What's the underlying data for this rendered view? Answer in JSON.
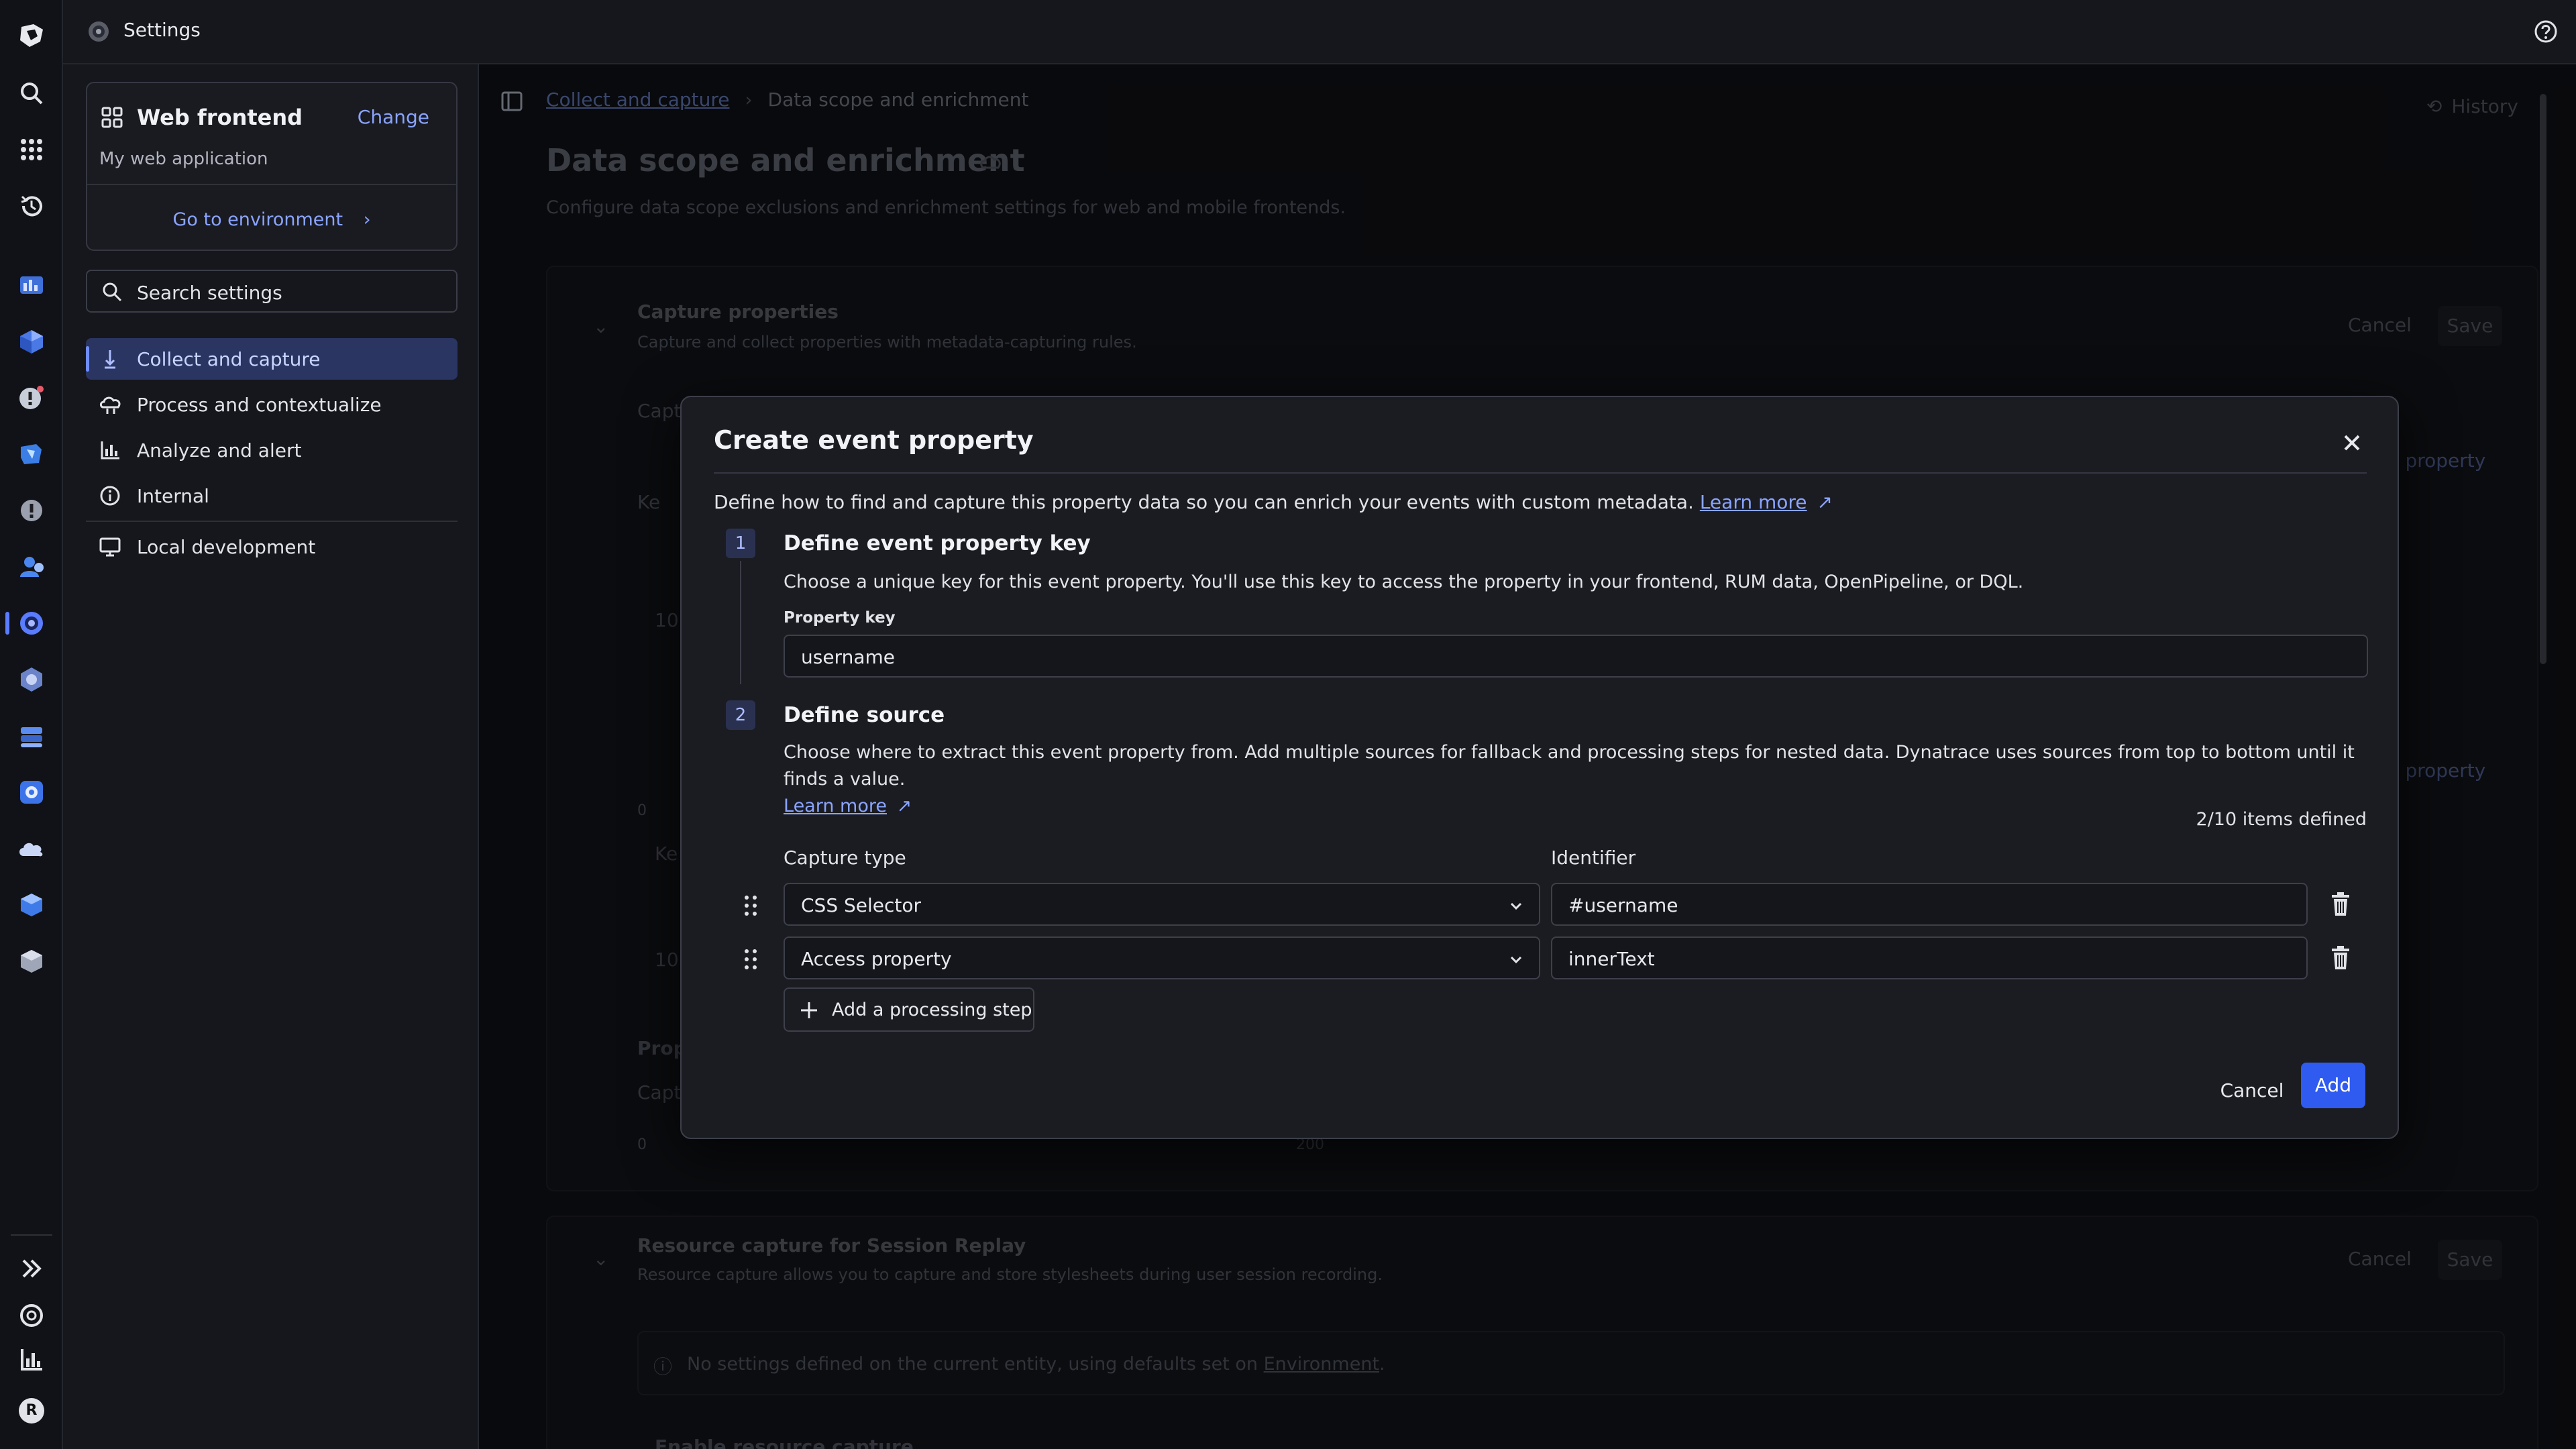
{
  "app": {
    "title": "Settings"
  },
  "rail": {
    "icons": [
      "dynatrace-logo-icon",
      "search-icon",
      "apps-grid-icon",
      "recent-history-icon",
      "dashboard-app-icon",
      "hub-app-icon",
      "problems-app-icon",
      "infrastructure-app-icon",
      "alerts-app-icon",
      "users-app-icon",
      "settings-app-icon",
      "kubernetes-app-icon",
      "databases-app-icon",
      "services-app-icon",
      "clouds-app-icon",
      "hosts-app-icon",
      "extensions-app-icon"
    ],
    "bottom_icons": [
      "expand-icon",
      "support-icon",
      "analytics-icon",
      "user-avatar-icon"
    ],
    "avatar_initial": "R"
  },
  "sidebar": {
    "app_card": {
      "name": "Web frontend",
      "change_label": "Change",
      "subtitle": "My web application",
      "go_label": "Go to environment"
    },
    "search_placeholder": "Search settings",
    "nav": [
      {
        "label": "Collect and capture",
        "icon": "collect-icon",
        "active": true
      },
      {
        "label": "Process and contextualize",
        "icon": "process-icon",
        "active": false
      },
      {
        "label": "Analyze and alert",
        "icon": "analyze-icon",
        "active": false
      },
      {
        "label": "Internal",
        "icon": "info-icon",
        "active": false
      },
      {
        "label": "Local development",
        "icon": "monitor-icon",
        "active": false
      }
    ]
  },
  "main": {
    "breadcrumb": {
      "parent": "Collect and capture",
      "current": "Data scope and enrichment"
    },
    "history_label": "History",
    "page_title": "Data scope and enrichment",
    "page_subtitle": "Configure data scope exclusions and enrichment settings for web and mobile frontends.",
    "section1": {
      "title": "Capture properties",
      "subtitle": "Capture and collect properties with metadata-capturing rules.",
      "cancel": "Cancel",
      "save": "Save"
    },
    "partial": {
      "capt1": "Capt",
      "ke1": "Ke",
      "ten1": "10",
      "newprop1": "v property",
      "newprop2": "v property",
      "zero1": "0",
      "ke2": "Ke",
      "ten2": "10",
      "prop": "Prop",
      "capt2": "Capt",
      "zero2": "0",
      "two_hundred": "200"
    },
    "section2": {
      "title": "Resource capture for Session Replay",
      "subtitle": "Resource capture allows you to capture and store stylesheets during user session recording.",
      "cancel": "Cancel",
      "save": "Save",
      "notice": "No settings defined on the current entity, using defaults set on",
      "notice_link": "Environment",
      "notice_end": ".",
      "bottom_label": "Enable resource capture"
    }
  },
  "modal": {
    "title": "Create event property",
    "description": "Define how to find and capture this property data so you can enrich your events with custom metadata.",
    "learn_more": "Learn more",
    "step1": {
      "number": "1",
      "title": "Define event property key",
      "description": "Choose a unique key for this event property. You'll use this key to access the property in your frontend, RUM data, OpenPipeline, or DQL.",
      "field_label": "Property key",
      "field_value": "username"
    },
    "step2": {
      "number": "2",
      "title": "Define source",
      "description": "Choose where to extract this event property from. Add multiple sources for fallback and processing steps for nested data. Dynatrace uses sources from top to bottom until it finds a value.",
      "learn_more": "Learn more",
      "items_count": "2/10 items defined",
      "col_capture_type": "Capture type",
      "col_identifier": "Identifier",
      "rows": [
        {
          "capture_type": "CSS Selector",
          "identifier": "#username"
        },
        {
          "capture_type": "Access property",
          "identifier": "innerText"
        }
      ],
      "add_step_label": "Add a processing step"
    },
    "cancel_label": "Cancel",
    "add_label": "Add"
  }
}
